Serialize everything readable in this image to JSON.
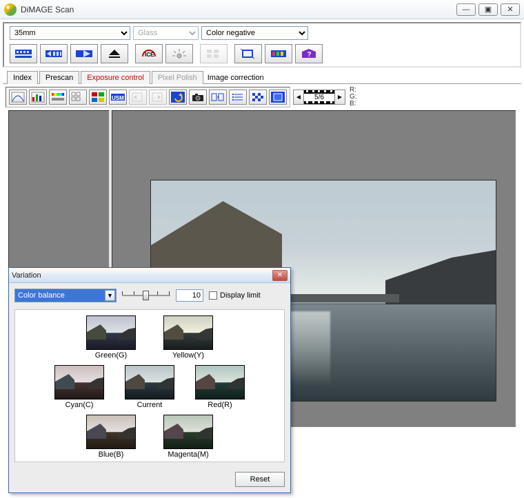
{
  "window": {
    "title": "DiMAGE Scan"
  },
  "topbar": {
    "film_format": "35mm",
    "holder": "Glass",
    "film_type": "Color negative"
  },
  "tabs": {
    "index": "Index",
    "prescan": "Prescan",
    "exposure": "Exposure control",
    "pixel_polish": "Pixel Polish",
    "image_corr": "Image correction"
  },
  "film": {
    "frame": "5/6"
  },
  "rgb": {
    "r": "R:",
    "g": "G:",
    "b": "B:"
  },
  "variation": {
    "title": "Variation",
    "mode": "Color balance",
    "step_value": "10",
    "display_limit": "Display limit",
    "green": "Green(G)",
    "yellow": "Yellow(Y)",
    "cyan": "Cyan(C)",
    "current": "Current",
    "red": "Red(R)",
    "blue": "Blue(B)",
    "magenta": "Magenta(M)",
    "reset": "Reset"
  }
}
